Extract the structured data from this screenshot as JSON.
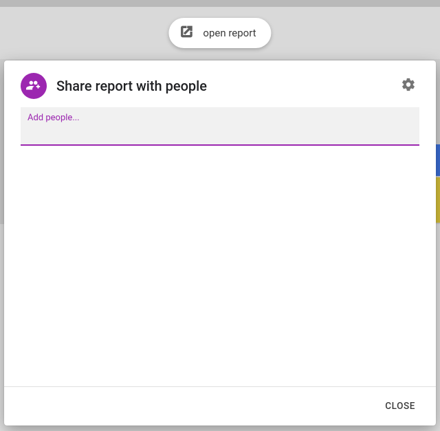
{
  "open_report": {
    "label": "open report"
  },
  "modal": {
    "title": "Share report with people",
    "input_label": "Add people...",
    "input_value": "",
    "close_label": "CLOSE"
  }
}
